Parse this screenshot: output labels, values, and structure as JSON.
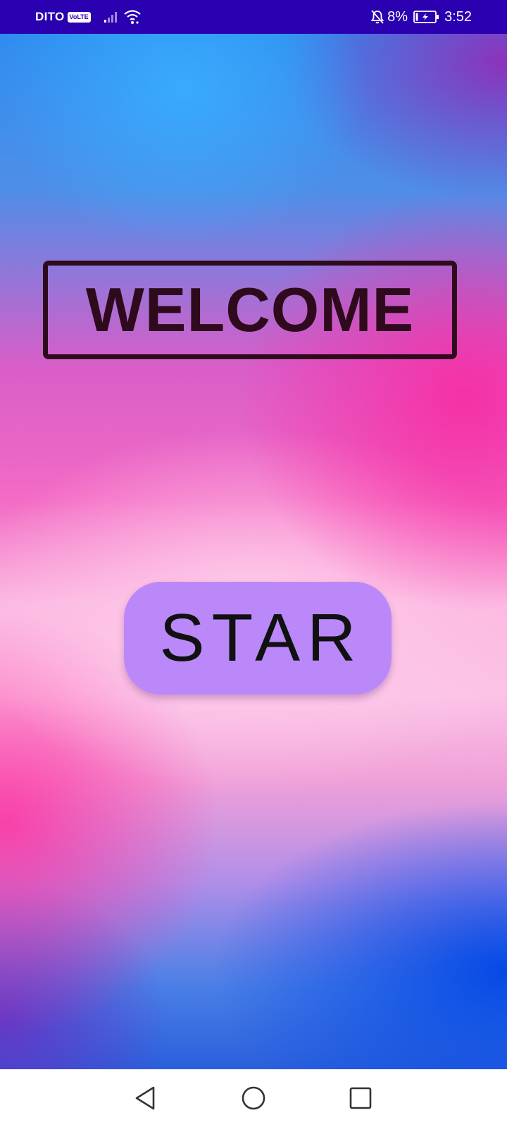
{
  "status_bar": {
    "carrier": "DITO",
    "network_badge": "VoLTE",
    "battery_percent": "8%",
    "time": "3:52",
    "icons": [
      "signal-icon",
      "wifi-icon",
      "bell-off-icon",
      "battery-icon"
    ],
    "background_color": "#2a00b0"
  },
  "main": {
    "welcome_title": "WELCOME",
    "start_button_label": "STAR",
    "button_color": "#bb88fa",
    "title_color": "#2e0a1c"
  },
  "nav_bar": {
    "icons": [
      "back-icon",
      "home-icon",
      "recents-icon"
    ]
  }
}
